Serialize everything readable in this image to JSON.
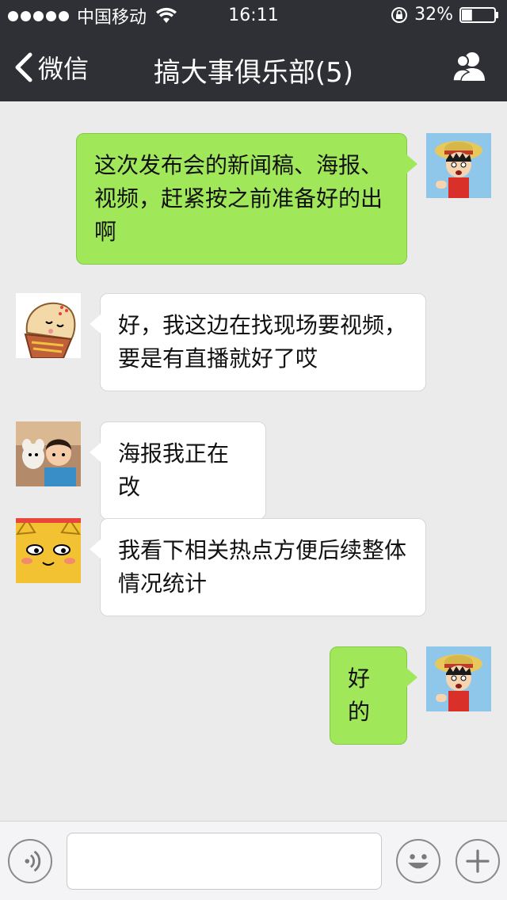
{
  "status_bar": {
    "carrier": "中国移动",
    "time": "16:11",
    "battery_percent": "32%",
    "battery_level": 0.32
  },
  "nav": {
    "back_label": "微信",
    "title": "搞大事俱乐部(5)"
  },
  "messages": [
    {
      "direction": "out",
      "text": "这次发布会的新闻稿、海报、视频，赶紧按之前准备好的出啊",
      "avatar_icon": "luffy-avatar"
    },
    {
      "direction": "in",
      "text": "好，我这边在找现场要视频，要是有直播就好了哎",
      "avatar_icon": "monk-cartoon-avatar"
    },
    {
      "direction": "in",
      "text": "海报我正在改",
      "avatar_icon": "child-with-dog-avatar"
    },
    {
      "direction": "in",
      "text": "我看下相关热点方便后续整体情况统计",
      "avatar_icon": "yellow-cat-avatar"
    },
    {
      "direction": "out",
      "text": "好的",
      "avatar_icon": "luffy-avatar"
    }
  ],
  "input_bar": {
    "placeholder": "",
    "value": ""
  },
  "colors": {
    "topbar": "#2e3035",
    "background": "#ebebeb",
    "outgoing_bubble": "#a0e75a",
    "incoming_bubble": "#ffffff"
  }
}
